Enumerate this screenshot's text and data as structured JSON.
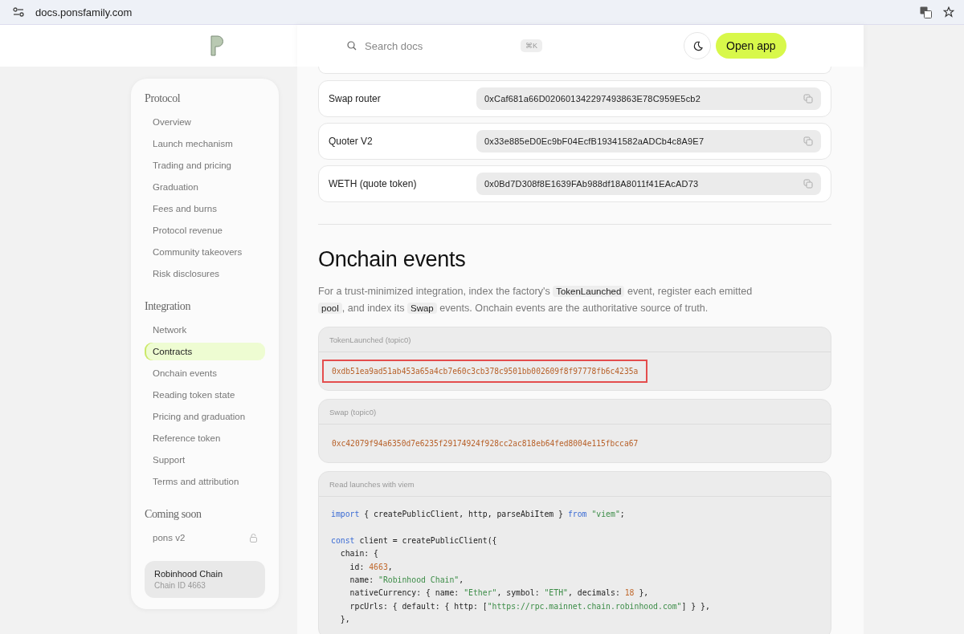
{
  "browser": {
    "url": "docs.ponsfamily.com"
  },
  "header": {
    "search_placeholder": "Search docs",
    "shortcut": "⌘K",
    "cta": "Open app"
  },
  "sidebar": {
    "sections": [
      {
        "title": "Protocol",
        "items": [
          {
            "label": "Overview",
            "selected": false
          },
          {
            "label": "Launch mechanism",
            "selected": false
          },
          {
            "label": "Trading and pricing",
            "selected": false
          },
          {
            "label": "Graduation",
            "selected": false
          },
          {
            "label": "Fees and burns",
            "selected": false
          },
          {
            "label": "Protocol revenue",
            "selected": false
          },
          {
            "label": "Community takeovers",
            "selected": false
          },
          {
            "label": "Risk disclosures",
            "selected": false
          }
        ]
      },
      {
        "title": "Integration",
        "items": [
          {
            "label": "Network",
            "selected": false
          },
          {
            "label": "Contracts",
            "selected": true
          },
          {
            "label": "Onchain events",
            "selected": false
          },
          {
            "label": "Reading token state",
            "selected": false
          },
          {
            "label": "Pricing and graduation",
            "selected": false
          },
          {
            "label": "Reference token",
            "selected": false
          },
          {
            "label": "Support",
            "selected": false
          },
          {
            "label": "Terms and attribution",
            "selected": false
          }
        ]
      },
      {
        "title": "Coming soon",
        "items": [
          {
            "label": "pons v2",
            "selected": false,
            "locked": true
          }
        ]
      }
    ],
    "chain": {
      "name": "Robinhood Chain",
      "id": "Chain ID 4663"
    }
  },
  "contracts": [
    {
      "name": "Swap router",
      "address": "0xCaf681a66D020601342297493863E78C959E5cb2"
    },
    {
      "name": "Quoter V2",
      "address": "0x33e885eD0Ec9bF04EcfB19341582aADCb4c8A9E7"
    },
    {
      "name": "WETH (quote token)",
      "address": "0x0Bd7D308f8E1639FAb988df18A8011f41EAcAD73"
    }
  ],
  "section": {
    "title": "Onchain events",
    "paragraph": [
      {
        "text": "For a trust-minimized integration, index the factory's ",
        "kind": "text"
      },
      {
        "text": "TokenLaunched",
        "kind": "code"
      },
      {
        "text": " event, register each emitted ",
        "kind": "text"
      },
      {
        "text": "pool",
        "kind": "code"
      },
      {
        "text": ", and index its ",
        "kind": "text"
      },
      {
        "text": "Swap",
        "kind": "code"
      },
      {
        "text": " events. Onchain events are the authoritative source of truth.",
        "kind": "text"
      }
    ]
  },
  "events": [
    {
      "label": "TokenLaunched (topic0)",
      "hash": "0xdb51ea9ad51ab453a65a4cb7e60c3cb378c9501bb002609f8f97778fb6c4235a",
      "highlighted": true
    },
    {
      "label": "Swap (topic0)",
      "hash": "0xc42079f94a6350d7e6235f29174924f928cc2ac818eb64fed8004e115fbcca67",
      "highlighted": false
    }
  ],
  "code_block": {
    "label": "Read launches with viem",
    "lines": [
      {
        "kind": "code",
        "tokens": [
          {
            "text": "import",
            "kind": "keyword"
          },
          {
            "text": " { createPublicClient, http, parseAbiItem } ",
            "kind": "plain"
          },
          {
            "text": "from ",
            "kind": "keyword"
          },
          {
            "text": "\"viem\"",
            "kind": "string"
          },
          {
            "text": ";",
            "kind": "plain"
          }
        ]
      },
      {
        "kind": "blank"
      },
      {
        "kind": "code",
        "tokens": [
          {
            "text": "const",
            "kind": "keyword"
          },
          {
            "text": " client = createPublicClient({",
            "kind": "plain"
          }
        ]
      },
      {
        "kind": "code",
        "tokens": [
          {
            "text": "  chain: {",
            "kind": "plain"
          }
        ]
      },
      {
        "kind": "code",
        "tokens": [
          {
            "text": "    id: ",
            "kind": "plain"
          },
          {
            "text": "4663",
            "kind": "number"
          },
          {
            "text": ",",
            "kind": "plain"
          }
        ]
      },
      {
        "kind": "code",
        "tokens": [
          {
            "text": "    name: ",
            "kind": "plain"
          },
          {
            "text": "\"Robinhood Chain\"",
            "kind": "string"
          },
          {
            "text": ",",
            "kind": "plain"
          }
        ]
      },
      {
        "kind": "code",
        "tokens": [
          {
            "text": "    nativeCurrency: { name: ",
            "kind": "plain"
          },
          {
            "text": "\"Ether\"",
            "kind": "string"
          },
          {
            "text": ", symbol: ",
            "kind": "plain"
          },
          {
            "text": "\"ETH\"",
            "kind": "string"
          },
          {
            "text": ", decimals: ",
            "kind": "plain"
          },
          {
            "text": "18",
            "kind": "number"
          },
          {
            "text": " },",
            "kind": "plain"
          }
        ]
      },
      {
        "kind": "code",
        "tokens": [
          {
            "text": "    rpcUrls: { default: { http: [",
            "kind": "plain"
          },
          {
            "text": "\"https://rpc.mainnet.chain.robinhood.com\"",
            "kind": "string"
          },
          {
            "text": "] } },",
            "kind": "plain"
          }
        ]
      },
      {
        "kind": "code",
        "tokens": [
          {
            "text": "  },",
            "kind": "plain"
          }
        ]
      }
    ]
  }
}
